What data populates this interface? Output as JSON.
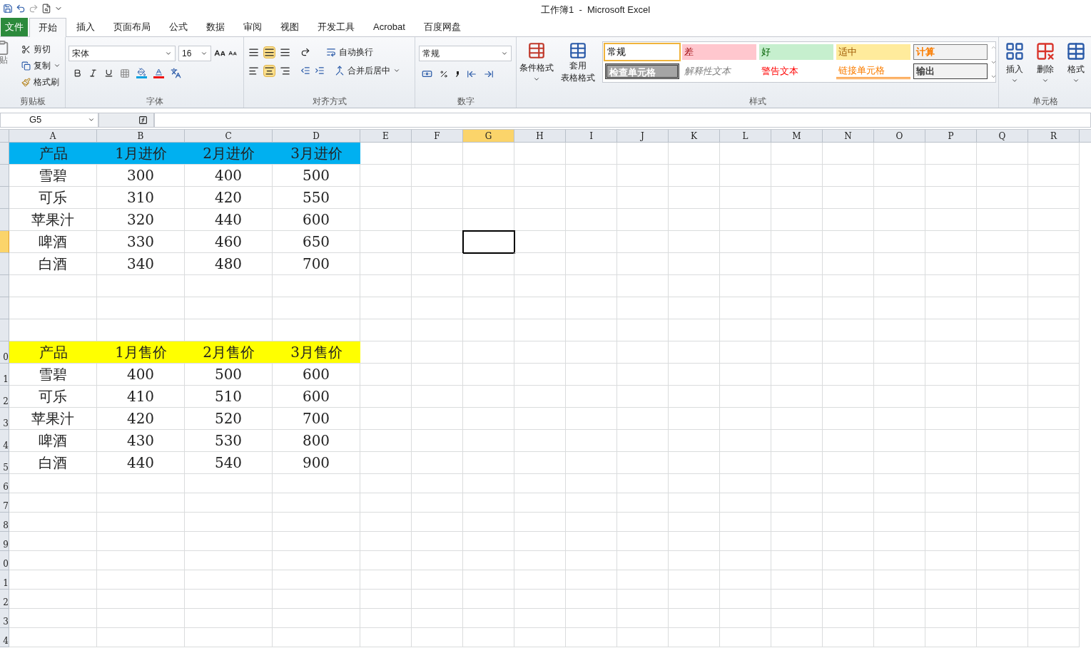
{
  "window": {
    "title": "工作簿1  -  Microsoft Excel"
  },
  "tabs": [
    {
      "label": "文件",
      "kind": "file",
      "selected": false
    },
    {
      "label": "开始",
      "kind": "tab",
      "selected": true
    },
    {
      "label": "插入",
      "kind": "tab",
      "selected": false
    },
    {
      "label": "页面布局",
      "kind": "tab",
      "selected": false
    },
    {
      "label": "公式",
      "kind": "tab",
      "selected": false
    },
    {
      "label": "数据",
      "kind": "tab",
      "selected": false
    },
    {
      "label": "审阅",
      "kind": "tab",
      "selected": false
    },
    {
      "label": "视图",
      "kind": "tab",
      "selected": false
    },
    {
      "label": "开发工具",
      "kind": "tab",
      "selected": false
    },
    {
      "label": "Acrobat",
      "kind": "tab",
      "selected": false
    },
    {
      "label": "百度网盘",
      "kind": "tab",
      "selected": false
    }
  ],
  "clipboard": {
    "paste": "贴",
    "cut": "剪切",
    "copy": "复制",
    "format_painter": "格式刷",
    "label": "剪贴板"
  },
  "font": {
    "name": "宋体",
    "size": "16",
    "label": "字体"
  },
  "alignment": {
    "wrap": "自动换行",
    "merge": "合并后居中",
    "label": "对齐方式"
  },
  "number": {
    "format": "常规",
    "label": "数字"
  },
  "styles": {
    "conditional": "条件格式",
    "table_format": [
      "套用",
      "表格格式"
    ],
    "label": "样式",
    "cells": [
      {
        "label": "常规",
        "kind": "normal",
        "selected": true
      },
      {
        "label": "差",
        "kind": "bad",
        "selected": false
      },
      {
        "label": "好",
        "kind": "good",
        "selected": false
      },
      {
        "label": "适中",
        "kind": "neutral",
        "selected": false
      },
      {
        "label": "计算",
        "kind": "calculation",
        "selected": false
      },
      {
        "label": "检查单元格",
        "kind": "check",
        "selected": false
      },
      {
        "label": "解释性文本",
        "kind": "explanatory",
        "selected": false
      },
      {
        "label": "警告文本",
        "kind": "warning",
        "selected": false
      },
      {
        "label": "链接单元格",
        "kind": "linked",
        "selected": false
      },
      {
        "label": "输出",
        "kind": "output",
        "selected": false
      }
    ]
  },
  "cells_group": {
    "insert": "插入",
    "delete": "删除",
    "format": "格式",
    "label": "单元格"
  },
  "formula_bar": {
    "name_box": "G5"
  },
  "columns": [
    {
      "label": "A",
      "selected": false
    },
    {
      "label": "B",
      "selected": false
    },
    {
      "label": "C",
      "selected": false
    },
    {
      "label": "D",
      "selected": false
    },
    {
      "label": "E",
      "selected": false
    },
    {
      "label": "F",
      "selected": false
    },
    {
      "label": "G",
      "selected": true
    },
    {
      "label": "H",
      "selected": false
    },
    {
      "label": "I",
      "selected": false
    },
    {
      "label": "J",
      "selected": false
    },
    {
      "label": "K",
      "selected": false
    },
    {
      "label": "L",
      "selected": false
    },
    {
      "label": "M",
      "selected": false
    },
    {
      "label": "N",
      "selected": false
    },
    {
      "label": "O",
      "selected": false
    },
    {
      "label": "P",
      "selected": false
    },
    {
      "label": "Q",
      "selected": false
    },
    {
      "label": "R",
      "selected": false
    }
  ],
  "rows": [
    {
      "selected": false,
      "color": "#00b0f0",
      "cells": [
        "产品",
        "1月进价",
        "2月进价",
        "3月进价"
      ]
    },
    {
      "selected": false,
      "cells": [
        "雪碧",
        "300",
        "400",
        "500"
      ]
    },
    {
      "selected": false,
      "cells": [
        "可乐",
        "310",
        "420",
        "550"
      ]
    },
    {
      "selected": false,
      "cells": [
        "苹果汁",
        "320",
        "440",
        "600"
      ]
    },
    {
      "selected": true,
      "cells": [
        "啤酒",
        "330",
        "460",
        "650"
      ]
    },
    {
      "selected": false,
      "cells": [
        "白酒",
        "340",
        "480",
        "700"
      ]
    },
    {
      "selected": false
    },
    {
      "selected": false
    },
    {
      "selected": false
    },
    {
      "header": "0",
      "selected": false,
      "color": "#ffff00",
      "cells": [
        "产品",
        "1月售价",
        "2月售价",
        "3月售价"
      ]
    },
    {
      "header": "1",
      "selected": false,
      "cells": [
        "雪碧",
        "400",
        "500",
        "600"
      ]
    },
    {
      "header": "2",
      "selected": false,
      "cells": [
        "可乐",
        "410",
        "510",
        "600"
      ]
    },
    {
      "header": "3",
      "selected": false,
      "cells": [
        "苹果汁",
        "420",
        "520",
        "700"
      ]
    },
    {
      "header": "4",
      "selected": false,
      "cells": [
        "啤酒",
        "430",
        "530",
        "800"
      ]
    },
    {
      "header": "5",
      "selected": false,
      "cells": [
        "白酒",
        "440",
        "540",
        "900"
      ]
    },
    {
      "header": "6",
      "selected": false
    },
    {
      "header": "7",
      "selected": false
    },
    {
      "header": "8",
      "selected": false
    },
    {
      "header": "9",
      "selected": false
    },
    {
      "header": "0",
      "selected": false
    },
    {
      "header": "1",
      "selected": false
    },
    {
      "header": "2",
      "selected": false
    },
    {
      "header": "3",
      "selected": false
    },
    {
      "header": "4",
      "selected": false
    }
  ]
}
